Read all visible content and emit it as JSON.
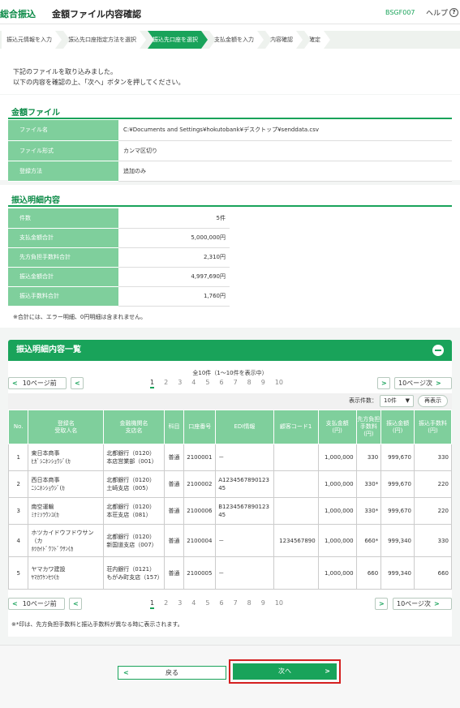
{
  "header": {
    "category": "総合振込",
    "title": "金額ファイル内容確認",
    "code": "BSGF007",
    "help": "ヘルプ",
    "help_icon": "?"
  },
  "steps": [
    "振込元情報を入力",
    "振込先口座指定方法を選択",
    "振込先口座を選択",
    "支払金額を入力",
    "内容確認",
    "確定"
  ],
  "message": [
    "下記のファイルを取り込みました。",
    "以下の内容を確認の上、「次へ」ボタンを押してください。"
  ],
  "file_section": {
    "title": "金額ファイル",
    "rows": [
      {
        "label": "ファイル名",
        "value": "C:¥Documents and Settings¥hokutobank¥デスクトップ¥senddata.csv"
      },
      {
        "label": "ファイル形式",
        "value": "カンマ区切り"
      },
      {
        "label": "登録方法",
        "value": "追加のみ"
      }
    ]
  },
  "detail_section": {
    "title": "振込明細内容",
    "rows": [
      {
        "label": "件数",
        "value": "5件"
      },
      {
        "label": "支払金額合計",
        "value": "5,000,000円"
      },
      {
        "label": "先方負担手数料合計",
        "value": "2,310円"
      },
      {
        "label": "振込金額合計",
        "value": "4,997,690円"
      },
      {
        "label": "振込手数料合計",
        "value": "1,760円"
      }
    ],
    "note": "※合計には、エラー明細、0円明細は含まれません。"
  },
  "list": {
    "title": "振込明細内容一覧",
    "count_text": "全10件（1～10件を表示中）",
    "prev10": "10ページ前",
    "next10": "10ページ次",
    "pages": [
      "1",
      "2",
      "3",
      "4",
      "5",
      "6",
      "7",
      "8",
      "9",
      "10"
    ],
    "display_label": "表示件数：",
    "display_value": "10件",
    "redisplay": "再表示",
    "columns": [
      "No.",
      "登録名\n受取人名",
      "金融機関名\n支店名",
      "科目",
      "口座番号",
      "EDI情報",
      "顧客コード1",
      "支払金額\n(円)",
      "先方負担\n手数料\n(円)",
      "振込金額\n(円)",
      "振込手数料\n(円)"
    ],
    "rows": [
      {
        "no": "1",
        "name": "東日本商事",
        "kana": "ﾋｶﾞｼﾆﾎﾝｼｮｳｼﾞ(ｶ",
        "bank": "北都銀行（0120）",
        "branch": "本店営業部（001）",
        "type": "普通",
        "acct": "2100001",
        "edi": "－",
        "cust": "",
        "pay": "1,000,000",
        "fee": "330",
        "amt": "999,670",
        "tf": "330"
      },
      {
        "no": "2",
        "name": "西日本商事",
        "kana": "ﾆｼﾆﾎﾝｼｮｳｼﾞ(ｶ",
        "bank": "北都銀行（0120）",
        "branch": "土崎支店（005）",
        "type": "普通",
        "acct": "2100002",
        "edi": "A123456789012345",
        "cust": "",
        "pay": "1,000,000",
        "fee": "330*",
        "amt": "999,670",
        "tf": "220"
      },
      {
        "no": "3",
        "name": "南空運輸",
        "kana": "ﾐﾅﾐｿﾗｳﾝﾕ(ｶ",
        "bank": "北都銀行（0120）",
        "branch": "本荘支店（081）",
        "type": "普通",
        "acct": "2100006",
        "edi": "B123456789012345",
        "cust": "",
        "pay": "1,000,000",
        "fee": "330*",
        "amt": "999,670",
        "tf": "220"
      },
      {
        "no": "4",
        "name": "ホツカイドウフドウサン（カ",
        "kana": "ﾎﾂｶｲﾄﾞｳﾌﾄﾞｳｻﾝ(ｶ",
        "bank": "北都銀行（0120）",
        "branch": "新国道支店（007）",
        "type": "普通",
        "acct": "2100004",
        "edi": "－",
        "cust": "1234567890",
        "pay": "1,000,000",
        "fee": "660*",
        "amt": "999,340",
        "tf": "330"
      },
      {
        "no": "5",
        "name": "ヤマカワ建設",
        "kana": "ﾔﾏｶﾜｹﾝｾﾂ(ｶ",
        "bank": "荘内銀行（0121）",
        "branch": "もがみ町支店（157）",
        "type": "普通",
        "acct": "2100005",
        "edi": "－",
        "cust": "",
        "pay": "1,000,000",
        "fee": "660",
        "amt": "999,340",
        "tf": "660"
      }
    ],
    "footnote": "※*印は、先方負担手数料と振込手数料が異なる時に表示されます。"
  },
  "buttons": {
    "back": "戻る",
    "next": "次へ"
  }
}
